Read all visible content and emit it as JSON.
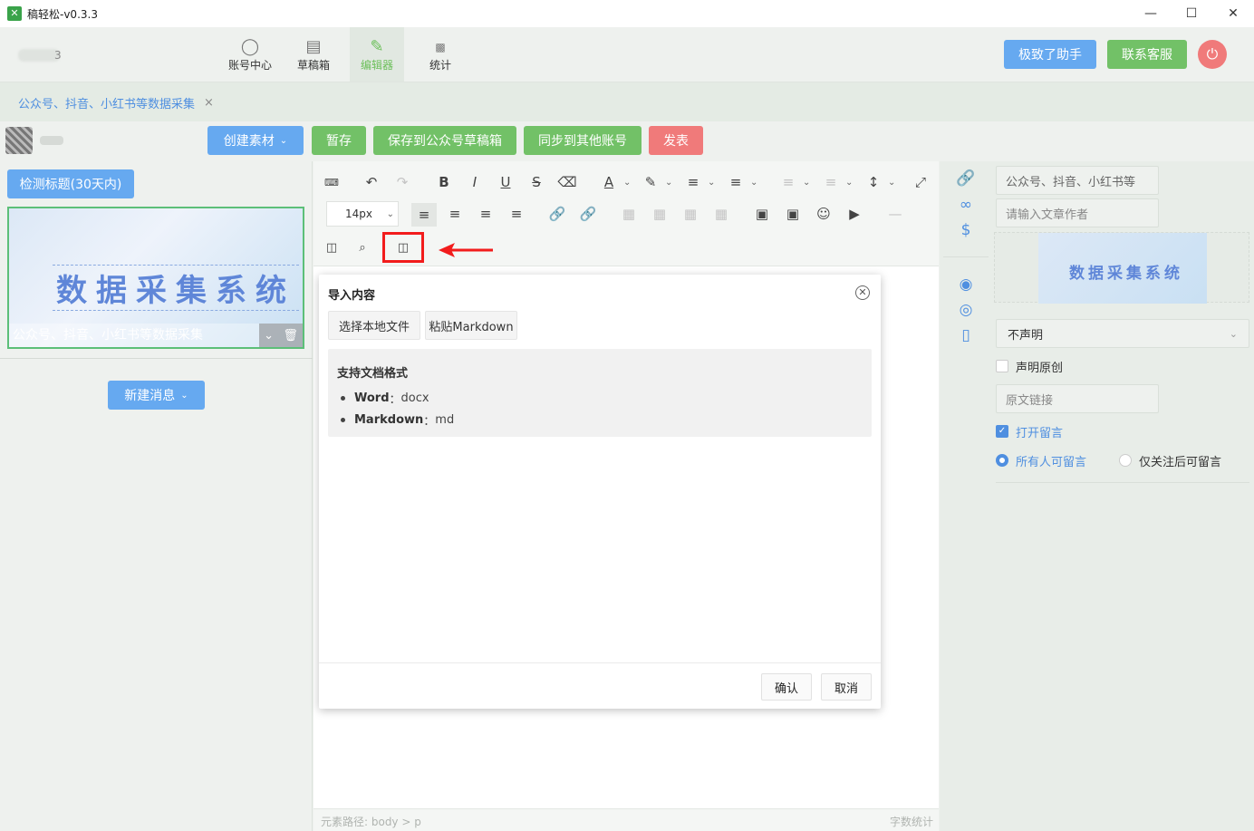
{
  "window": {
    "title": "稿轻松-v0.3.3",
    "controls": [
      "—",
      "☐",
      "✕"
    ]
  },
  "topnav": {
    "user_tail": "3",
    "items": [
      {
        "label": "账号中心",
        "icon": "user-icon"
      },
      {
        "label": "草稿箱",
        "icon": "printer-icon"
      },
      {
        "label": "编辑器",
        "icon": "pen-icon"
      },
      {
        "label": "统计",
        "icon": "bar-chart-icon"
      }
    ],
    "assistant_label": "极致了助手",
    "support_label": "联系客服"
  },
  "tabs": [
    {
      "label": "公众号、抖音、小红书等数据采集",
      "close": "×"
    }
  ],
  "actions": {
    "create_label": "创建素材",
    "save_temp_label": "暂存",
    "save_draft_label": "保存到公众号草稿箱",
    "sync_label": "同步到其他账号",
    "publish_label": "发表"
  },
  "left": {
    "check_title_label": "检测标题(30天内)",
    "cover_title": "数据采集系统",
    "cover_caption": "公众号、抖音、小红书等数据采集",
    "new_message_label": "新建消息"
  },
  "editor": {
    "font_size": "14px",
    "status_path": "元素路径: body > p",
    "status_count": "字数统计"
  },
  "dialog": {
    "title": "导入内容",
    "choose_file_label": "选择本地文件",
    "paste_md_label": "粘贴Markdown",
    "info_title": "支持文档格式",
    "formats": [
      {
        "name": "Word",
        "sep": "：",
        "ext": "docx"
      },
      {
        "name": "Markdown",
        "sep": "：",
        "ext": "md"
      }
    ],
    "confirm_label": "确认",
    "cancel_label": "取消"
  },
  "right": {
    "title_value": "公众号、抖音、小红书等",
    "author_placeholder": "请输入文章作者",
    "thumb_title": "数据采集系统",
    "declare_value": "不声明",
    "original_label": "声明原创",
    "source_link_placeholder": "原文链接",
    "open_comment_label": "打开留言",
    "comment_all_label": "所有人可留言",
    "comment_follow_label": "仅关注后可留言"
  },
  "colors": {
    "blue": "#66a9f0",
    "green": "#72c167",
    "red": "#f07a7a",
    "accent_blue": "#4f8fe0",
    "highlight": "#f21c1c"
  }
}
